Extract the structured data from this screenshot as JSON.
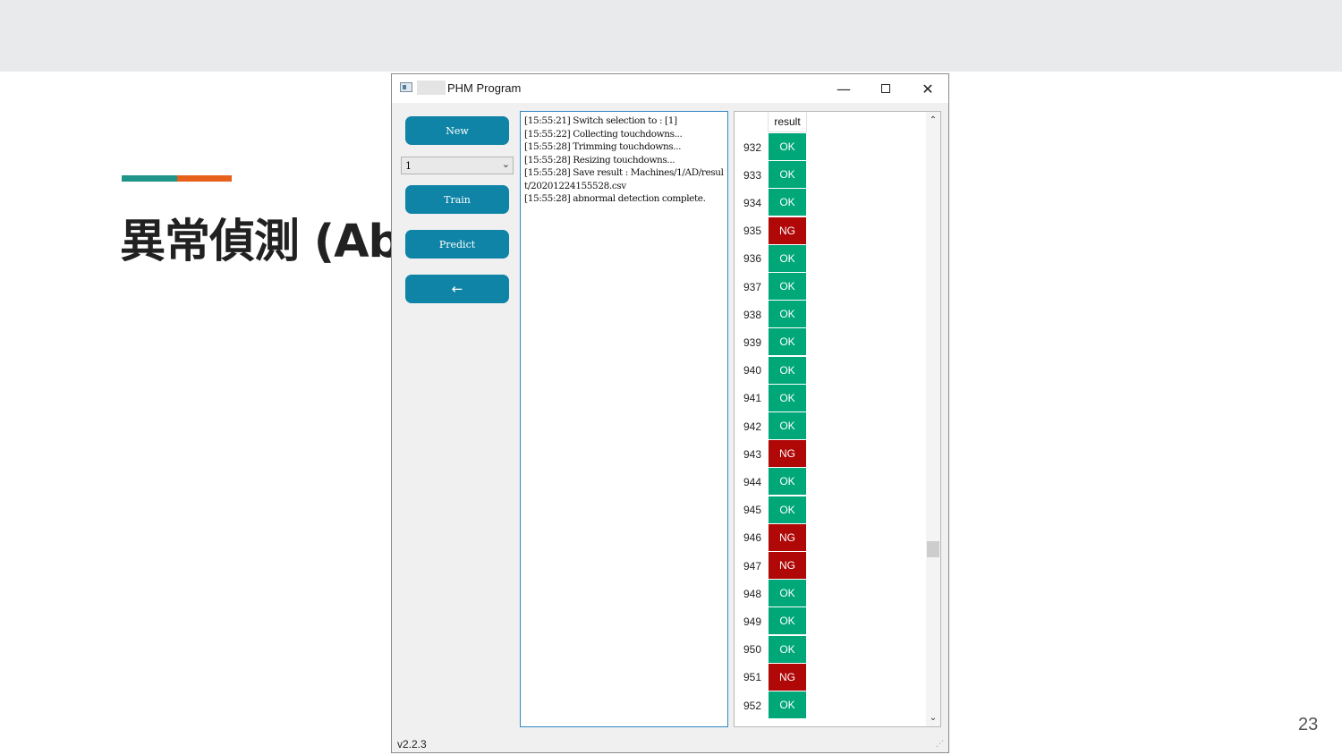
{
  "slide": {
    "title": "異常偵測 (Ab",
    "page_number": "23"
  },
  "window": {
    "title": "PHM Program",
    "controls": {
      "minimize": "—",
      "close": "✕"
    }
  },
  "sidebar": {
    "new_label": "New",
    "selection_value": "1",
    "train_label": "Train",
    "predict_label": "Predict",
    "back_label": "←"
  },
  "log": {
    "lines": [
      "[15:55:21] Switch selection to : [1]",
      "[15:55:22] Collecting touchdowns...",
      "[15:55:28] Trimming touchdowns...",
      "[15:55:28] Resizing touchdowns...",
      "[15:55:28] Save result : Machines/1/AD/result/20201224155528.csv",
      "[15:55:28] abnormal detection complete."
    ]
  },
  "results_table": {
    "column_header": "result",
    "rows": [
      {
        "index": "932",
        "result": "OK"
      },
      {
        "index": "933",
        "result": "OK"
      },
      {
        "index": "934",
        "result": "OK"
      },
      {
        "index": "935",
        "result": "NG"
      },
      {
        "index": "936",
        "result": "OK"
      },
      {
        "index": "937",
        "result": "OK"
      },
      {
        "index": "938",
        "result": "OK"
      },
      {
        "index": "939",
        "result": "OK"
      },
      {
        "index": "940",
        "result": "OK"
      },
      {
        "index": "941",
        "result": "OK"
      },
      {
        "index": "942",
        "result": "OK"
      },
      {
        "index": "943",
        "result": "NG"
      },
      {
        "index": "944",
        "result": "OK"
      },
      {
        "index": "945",
        "result": "OK"
      },
      {
        "index": "946",
        "result": "NG"
      },
      {
        "index": "947",
        "result": "NG"
      },
      {
        "index": "948",
        "result": "OK"
      },
      {
        "index": "949",
        "result": "OK"
      },
      {
        "index": "950",
        "result": "OK"
      },
      {
        "index": "951",
        "result": "NG"
      },
      {
        "index": "952",
        "result": "OK"
      }
    ]
  },
  "footer": {
    "version": "v2.2.3"
  },
  "colors": {
    "ok": "#00a779",
    "ng": "#b00707",
    "button": "#0f84a7",
    "accent_teal": "#1f9488",
    "accent_orange": "#e8611c"
  }
}
